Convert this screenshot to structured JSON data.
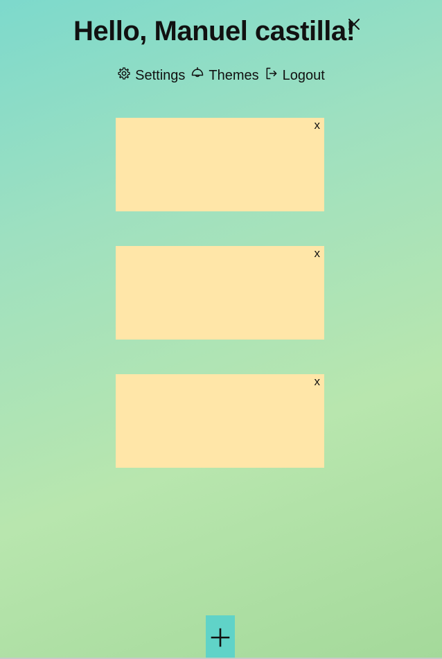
{
  "header": {
    "greeting": "Hello, Manuel castilla!",
    "close_icon": "close-icon"
  },
  "nav": {
    "items": [
      {
        "label": "Settings",
        "icon": "gear-icon"
      },
      {
        "label": "Themes",
        "icon": "theme-lamp-icon"
      },
      {
        "label": "Logout",
        "icon": "logout-icon"
      }
    ]
  },
  "notes": [
    {
      "close_label": "x",
      "content": ""
    },
    {
      "close_label": "x",
      "content": ""
    },
    {
      "close_label": "x",
      "content": ""
    }
  ],
  "add_button": {
    "icon": "plus-icon"
  },
  "colors": {
    "note_background": "#ffe6a8",
    "add_button_background": "#60d3c8",
    "gradient_start": "#7dd9cc",
    "gradient_end": "#a4d99a"
  }
}
